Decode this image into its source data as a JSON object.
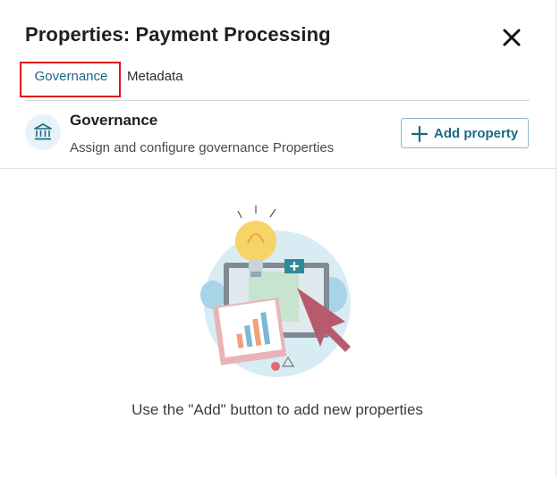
{
  "panel": {
    "title": "Properties: Payment Processing",
    "close_icon": "close-icon"
  },
  "tabs": [
    {
      "label": "Governance",
      "active": true
    },
    {
      "label": "Metadata",
      "active": false
    }
  ],
  "section": {
    "icon": "bank-icon",
    "title": "Governance",
    "description": "Assign and configure governance Properties",
    "add_button": {
      "icon": "plus-icon",
      "label": "Add property"
    }
  },
  "empty_state": {
    "illustration": "lightbulb-dashboard-illustration",
    "message": "Use the \"Add\" button to add new properties"
  },
  "colors": {
    "accent": "#1a6a86",
    "highlight_border": "#e0101a",
    "icon_bg": "#e6f3f7"
  }
}
